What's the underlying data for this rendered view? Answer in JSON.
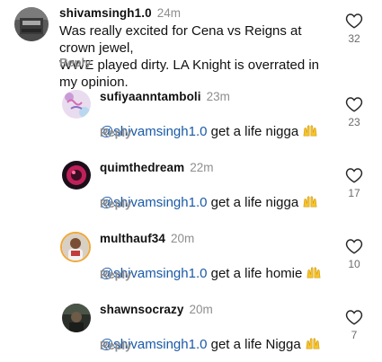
{
  "comments": [
    {
      "username": "shivamsingh1.0",
      "time": "24m",
      "text": "Was really excited for Cena vs Reigns at crown jewel,\nWWE played dirty. LA Knight is overrated in my opinion.",
      "reply_label": "Reply",
      "likes": "32"
    }
  ],
  "replies": [
    {
      "username": "sufiyaanntamboli",
      "time": "23m",
      "mention": "@shivamsingh1.0",
      "text": " get a life nigga",
      "emoji": "raising-hands",
      "reply_label": "Reply",
      "likes": "23"
    },
    {
      "username": "quimthedream",
      "time": "22m",
      "mention": "@shivamsingh1.0",
      "text": " get a life nigga",
      "emoji": "raising-hands",
      "reply_label": "Reply",
      "likes": "17"
    },
    {
      "username": "multhauf34",
      "time": "20m",
      "mention": "@shivamsingh1.0",
      "text": " get a life homie",
      "emoji": "raising-hands",
      "reply_label": "Reply",
      "likes": "10"
    },
    {
      "username": "shawnsocrazy",
      "time": "20m",
      "mention": "@shivamsingh1.0",
      "text": " get a life Nigga",
      "emoji": "raising-hands",
      "reply_label": "Reply",
      "likes": "7"
    }
  ],
  "colors": {
    "mention": "#1a5aa8",
    "muted": "#8e8e8e",
    "text": "#111111",
    "emoji": "#f5c52c"
  },
  "icons": [
    "heart-outline-icon",
    "raising-hands-emoji"
  ]
}
